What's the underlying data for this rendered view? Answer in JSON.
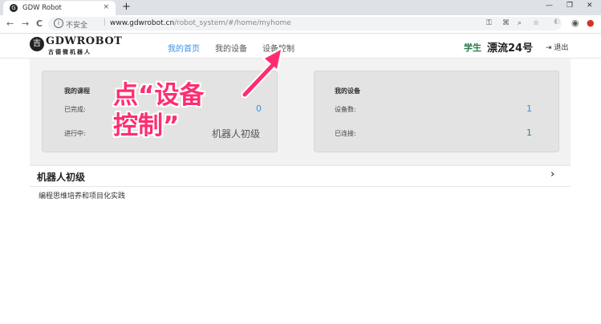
{
  "browser": {
    "tab_title": "GDW Robot",
    "tab_favicon": "G",
    "new_tab": "+",
    "close_tab": "×",
    "win_min": "—",
    "win_max": "❐",
    "win_close": "✕",
    "nav_back": "←",
    "nav_forward": "→",
    "nav_reload": "C",
    "insecure_label": "不安全",
    "address_separator": "|",
    "url_host": "www.gdwrobot.cn",
    "url_path": "/robot_system/#/home/myhome"
  },
  "site": {
    "logo_text": "GDWROBOT",
    "logo_subtitle": "古德微机器人",
    "logo_emblem": "吉",
    "menu": [
      {
        "label": "我的首页",
        "active": true
      },
      {
        "label": "我的设备",
        "active": false
      },
      {
        "label": "设备控制",
        "active": false
      }
    ],
    "role": "学生",
    "username": "漂流24号",
    "logout_icon": "⇥",
    "logout_label": "退出"
  },
  "courses_card": {
    "title": "我的课程",
    "completed_label": "已完成:",
    "completed_value": "0",
    "in_progress_label": "进行中:",
    "in_progress_value": "机器人初级"
  },
  "devices_card": {
    "title": "我的设备",
    "count_label": "设备数:",
    "count_value": "1",
    "connected_label": "已连接:",
    "connected_value": "1"
  },
  "course_section": {
    "title": "机器人初级",
    "arrow": "›",
    "description": "编程思维培养和项目化实践"
  },
  "annotation": {
    "line1": "点“设备",
    "line2": "控制”",
    "color": "#ff2d6f"
  }
}
